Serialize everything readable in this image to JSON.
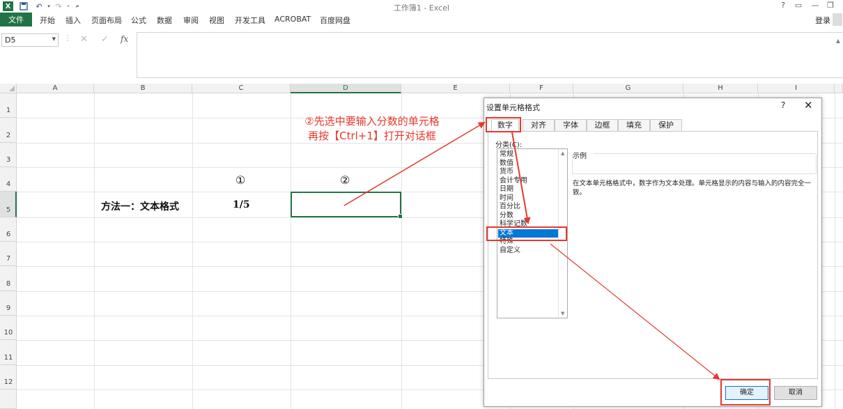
{
  "window": {
    "logo": "X",
    "title": "工作簿1 - Excel",
    "help": "?",
    "ribbon_opts": "▭",
    "minimize": "—",
    "restore": "❐"
  },
  "ribbon": {
    "file": "文件",
    "tabs": [
      "开始",
      "插入",
      "页面布局",
      "公式",
      "数据",
      "审阅",
      "视图",
      "开发工具",
      "ACROBAT",
      "百度网盘"
    ],
    "login": "登录"
  },
  "formula_bar": {
    "name_box": "D5",
    "cancel": "✕",
    "enter": "✓",
    "fx": "fx",
    "value": ""
  },
  "sheet": {
    "columns": [
      "A",
      "B",
      "C",
      "D",
      "E",
      "F",
      "G",
      "H",
      "I"
    ],
    "rows": [
      "1",
      "2",
      "3",
      "4",
      "5",
      "6",
      "7",
      "8",
      "9",
      "10",
      "11",
      "12"
    ],
    "selected_cell": "D5",
    "cells": {
      "B5": "方法一：文本格式",
      "C4": "①",
      "C5": "1/5",
      "D4": "②"
    }
  },
  "annotation": {
    "line1": "②先选中要输入分数的单元格",
    "line2": "再按【Ctrl+1】打开对话框",
    "color": "#e8372c"
  },
  "dialog": {
    "title": "设置单元格格式",
    "help": "?",
    "close": "✕",
    "tabs": [
      "数字",
      "对齐",
      "字体",
      "边框",
      "填充",
      "保护"
    ],
    "active_tab": "数字",
    "category_label": "分类(C):",
    "categories": [
      "常规",
      "数值",
      "货币",
      "会计专用",
      "日期",
      "时间",
      "百分比",
      "分数",
      "科学记数",
      "文本",
      "特殊",
      "自定义"
    ],
    "selected_category": "文本",
    "sample_label": "示例",
    "description": "在文本单元格格式中，数字作为文本处理。单元格显示的内容与输入的内容完全一致。",
    "ok": "确定",
    "cancel": "取消"
  },
  "colors": {
    "excel_green": "#217346",
    "selection_blue": "#0078d7",
    "annotation_red": "#e8372c"
  }
}
